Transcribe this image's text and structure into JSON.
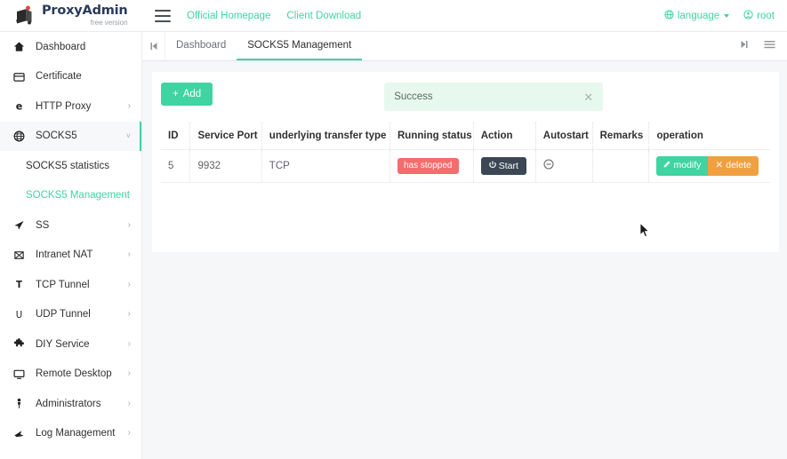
{
  "brand": {
    "title": "ProxyAdmin",
    "subtitle": "free version",
    "logo_icon": "cube-logo-icon"
  },
  "topnav": {
    "menu_icon": "hamburger-menu-icon",
    "links": [
      {
        "label": "Official Homepage",
        "name": "official-homepage-link"
      },
      {
        "label": "Client Download",
        "name": "client-download-link"
      }
    ],
    "language": {
      "label": "language",
      "icon": "globe-icon"
    },
    "user": {
      "label": "root",
      "icon": "user-circle-icon"
    }
  },
  "sidebar": {
    "items": [
      {
        "label": "Dashboard",
        "icon": "home-icon",
        "expandable": false,
        "active": false
      },
      {
        "label": "Certificate",
        "icon": "certificate-icon",
        "expandable": false,
        "active": false
      },
      {
        "label": "HTTP Proxy",
        "icon": "http-proxy-icon",
        "expandable": true,
        "active": false
      },
      {
        "label": "SOCKS5",
        "icon": "globe-icon",
        "expandable": true,
        "active": true,
        "expanded": true
      },
      {
        "label": "SS",
        "icon": "send-icon",
        "expandable": true,
        "active": false
      },
      {
        "label": "Intranet NAT",
        "icon": "nat-icon",
        "expandable": true,
        "active": false
      },
      {
        "label": "TCP Tunnel",
        "icon": "tcp-icon",
        "expandable": true,
        "active": false
      },
      {
        "label": "UDP Tunnel",
        "icon": "udp-icon",
        "expandable": true,
        "active": false
      },
      {
        "label": "DIY Service",
        "icon": "puzzle-icon",
        "expandable": true,
        "active": false
      },
      {
        "label": "Remote Desktop",
        "icon": "monitor-icon",
        "expandable": true,
        "active": false
      },
      {
        "label": "Administrators",
        "icon": "person-icon",
        "expandable": true,
        "active": false
      },
      {
        "label": "Log Management",
        "icon": "log-icon",
        "expandable": true,
        "active": false
      }
    ],
    "socks5_sub": [
      {
        "label": "SOCKS5 statistics",
        "active": false
      },
      {
        "label": "SOCKS5 Management",
        "active": true
      }
    ]
  },
  "tabbar": {
    "back_icon": "skip-back-icon",
    "forward_icon": "skip-forward-icon",
    "list_icon": "list-menu-icon",
    "tabs": [
      {
        "label": "Dashboard",
        "active": false
      },
      {
        "label": "SOCKS5 Management",
        "active": true
      }
    ]
  },
  "toolbar": {
    "add_label": "Add",
    "add_icon": "plus-icon"
  },
  "alert": {
    "message": "Success",
    "close_icon": "close-icon"
  },
  "table": {
    "columns": [
      "ID",
      "Service Port",
      "underlying transfer type",
      "Running status",
      "Action",
      "Autostart",
      "Remarks",
      "operation"
    ],
    "rows": [
      {
        "id": "5",
        "service_port": "9932",
        "transfer_type": "TCP",
        "running_status": "has stopped",
        "action_label": "Start",
        "action_icon": "power-icon",
        "autostart_icon": "circle-minus-icon",
        "remarks": "",
        "modify_label": "modify",
        "modify_icon": "pencil-icon",
        "delete_label": "delete",
        "delete_icon": "cross-icon"
      }
    ]
  },
  "colors": {
    "accent": "#3fd4a2",
    "danger": "#f56c6c",
    "warning": "#f0a040",
    "dark_button": "#3c4654",
    "alert_bg": "#e7f8ef",
    "brand_text": "#2b3a5c"
  }
}
